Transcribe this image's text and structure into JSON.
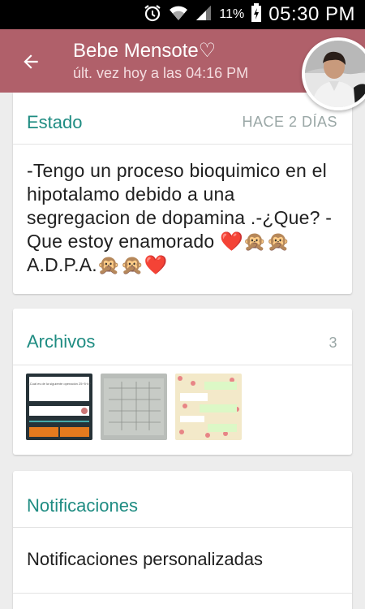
{
  "status_bar": {
    "battery_percent": "11%",
    "time": "05:30 PM"
  },
  "header": {
    "contact_name": "Bebe Mensote♡",
    "last_seen": "últ. vez hoy a las 04:16 PM"
  },
  "status": {
    "title": "Estado",
    "age": "HACE 2 DÍAS",
    "text": "-Tengo un proceso bioquimico en el hipotalamo debido a una segregacion de dopamina .-¿Que? -Que estoy enamorado ❤️🙊🙊 A.D.P.A.🙊🙊❤️"
  },
  "files": {
    "title": "Archivos",
    "count": "3",
    "thumbs": [
      {
        "name": "quiz-screenshot",
        "caption": "¿Cuál es de la siguiente operación 25÷5·6?"
      },
      {
        "name": "handwritten-table"
      },
      {
        "name": "chat-screenshot"
      }
    ]
  },
  "notifications": {
    "title": "Notificaciones",
    "custom_label": "Notificaciones personalizadas"
  },
  "colors": {
    "appbar": "#b0606a",
    "accent": "#1f8c82"
  }
}
